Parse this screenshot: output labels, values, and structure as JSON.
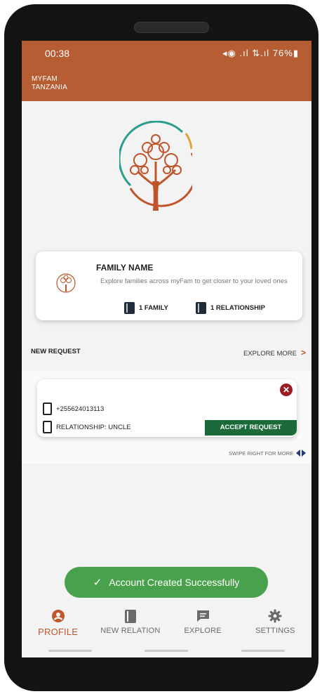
{
  "status_bar": {
    "time": "00:38",
    "battery": "76%"
  },
  "app": {
    "name_line1": "MYFAM",
    "name_line2": "TANZANIA"
  },
  "family_card": {
    "title": "FAMILY NAME",
    "description": "Explore families across myFam to get closer to your loved ones",
    "families": "1 FAMILY",
    "relationships": "1 RELATIONSHIP"
  },
  "requests": {
    "section_title": "NEW REQUEST",
    "explore_more": "EXPLORE MORE",
    "phone": "+255624013113",
    "relationship": "RELATIONSHIP: UNCLE",
    "accept_label": "ACCEPT REQUEST",
    "swipe_hint": "SWIPE RIGHT FOR MORE"
  },
  "toast": {
    "message": "Account Created Successfully"
  },
  "nav": [
    {
      "label": "PROFILE",
      "icon": "profile-icon",
      "active": true
    },
    {
      "label": "NEW RELATION",
      "icon": "book-icon",
      "active": false
    },
    {
      "label": "EXPLORE",
      "icon": "chat-icon",
      "active": false
    },
    {
      "label": "SETTINGS",
      "icon": "gear-icon",
      "active": false
    }
  ],
  "colors": {
    "header": "#b65d34",
    "accent": "#c0552c",
    "accept": "#1b6b3a",
    "toast": "#4aa14d",
    "close": "#9d1c22"
  }
}
